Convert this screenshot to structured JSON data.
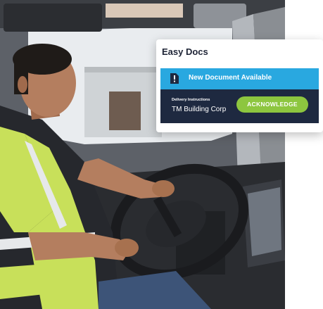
{
  "notification": {
    "app_title": "Easy Docs",
    "alert_text": "New Document Available",
    "alert_icon": "document-alert-icon",
    "detail_label": "Delivery Instructions",
    "detail_value": "TM Building Corp",
    "action_label": "ACKNOWLEDGE"
  },
  "colors": {
    "alert_bar": "#29a8e0",
    "details_panel": "#1e2940",
    "action_button": "#8dc63f",
    "safety_vest": "#c8e05a"
  }
}
